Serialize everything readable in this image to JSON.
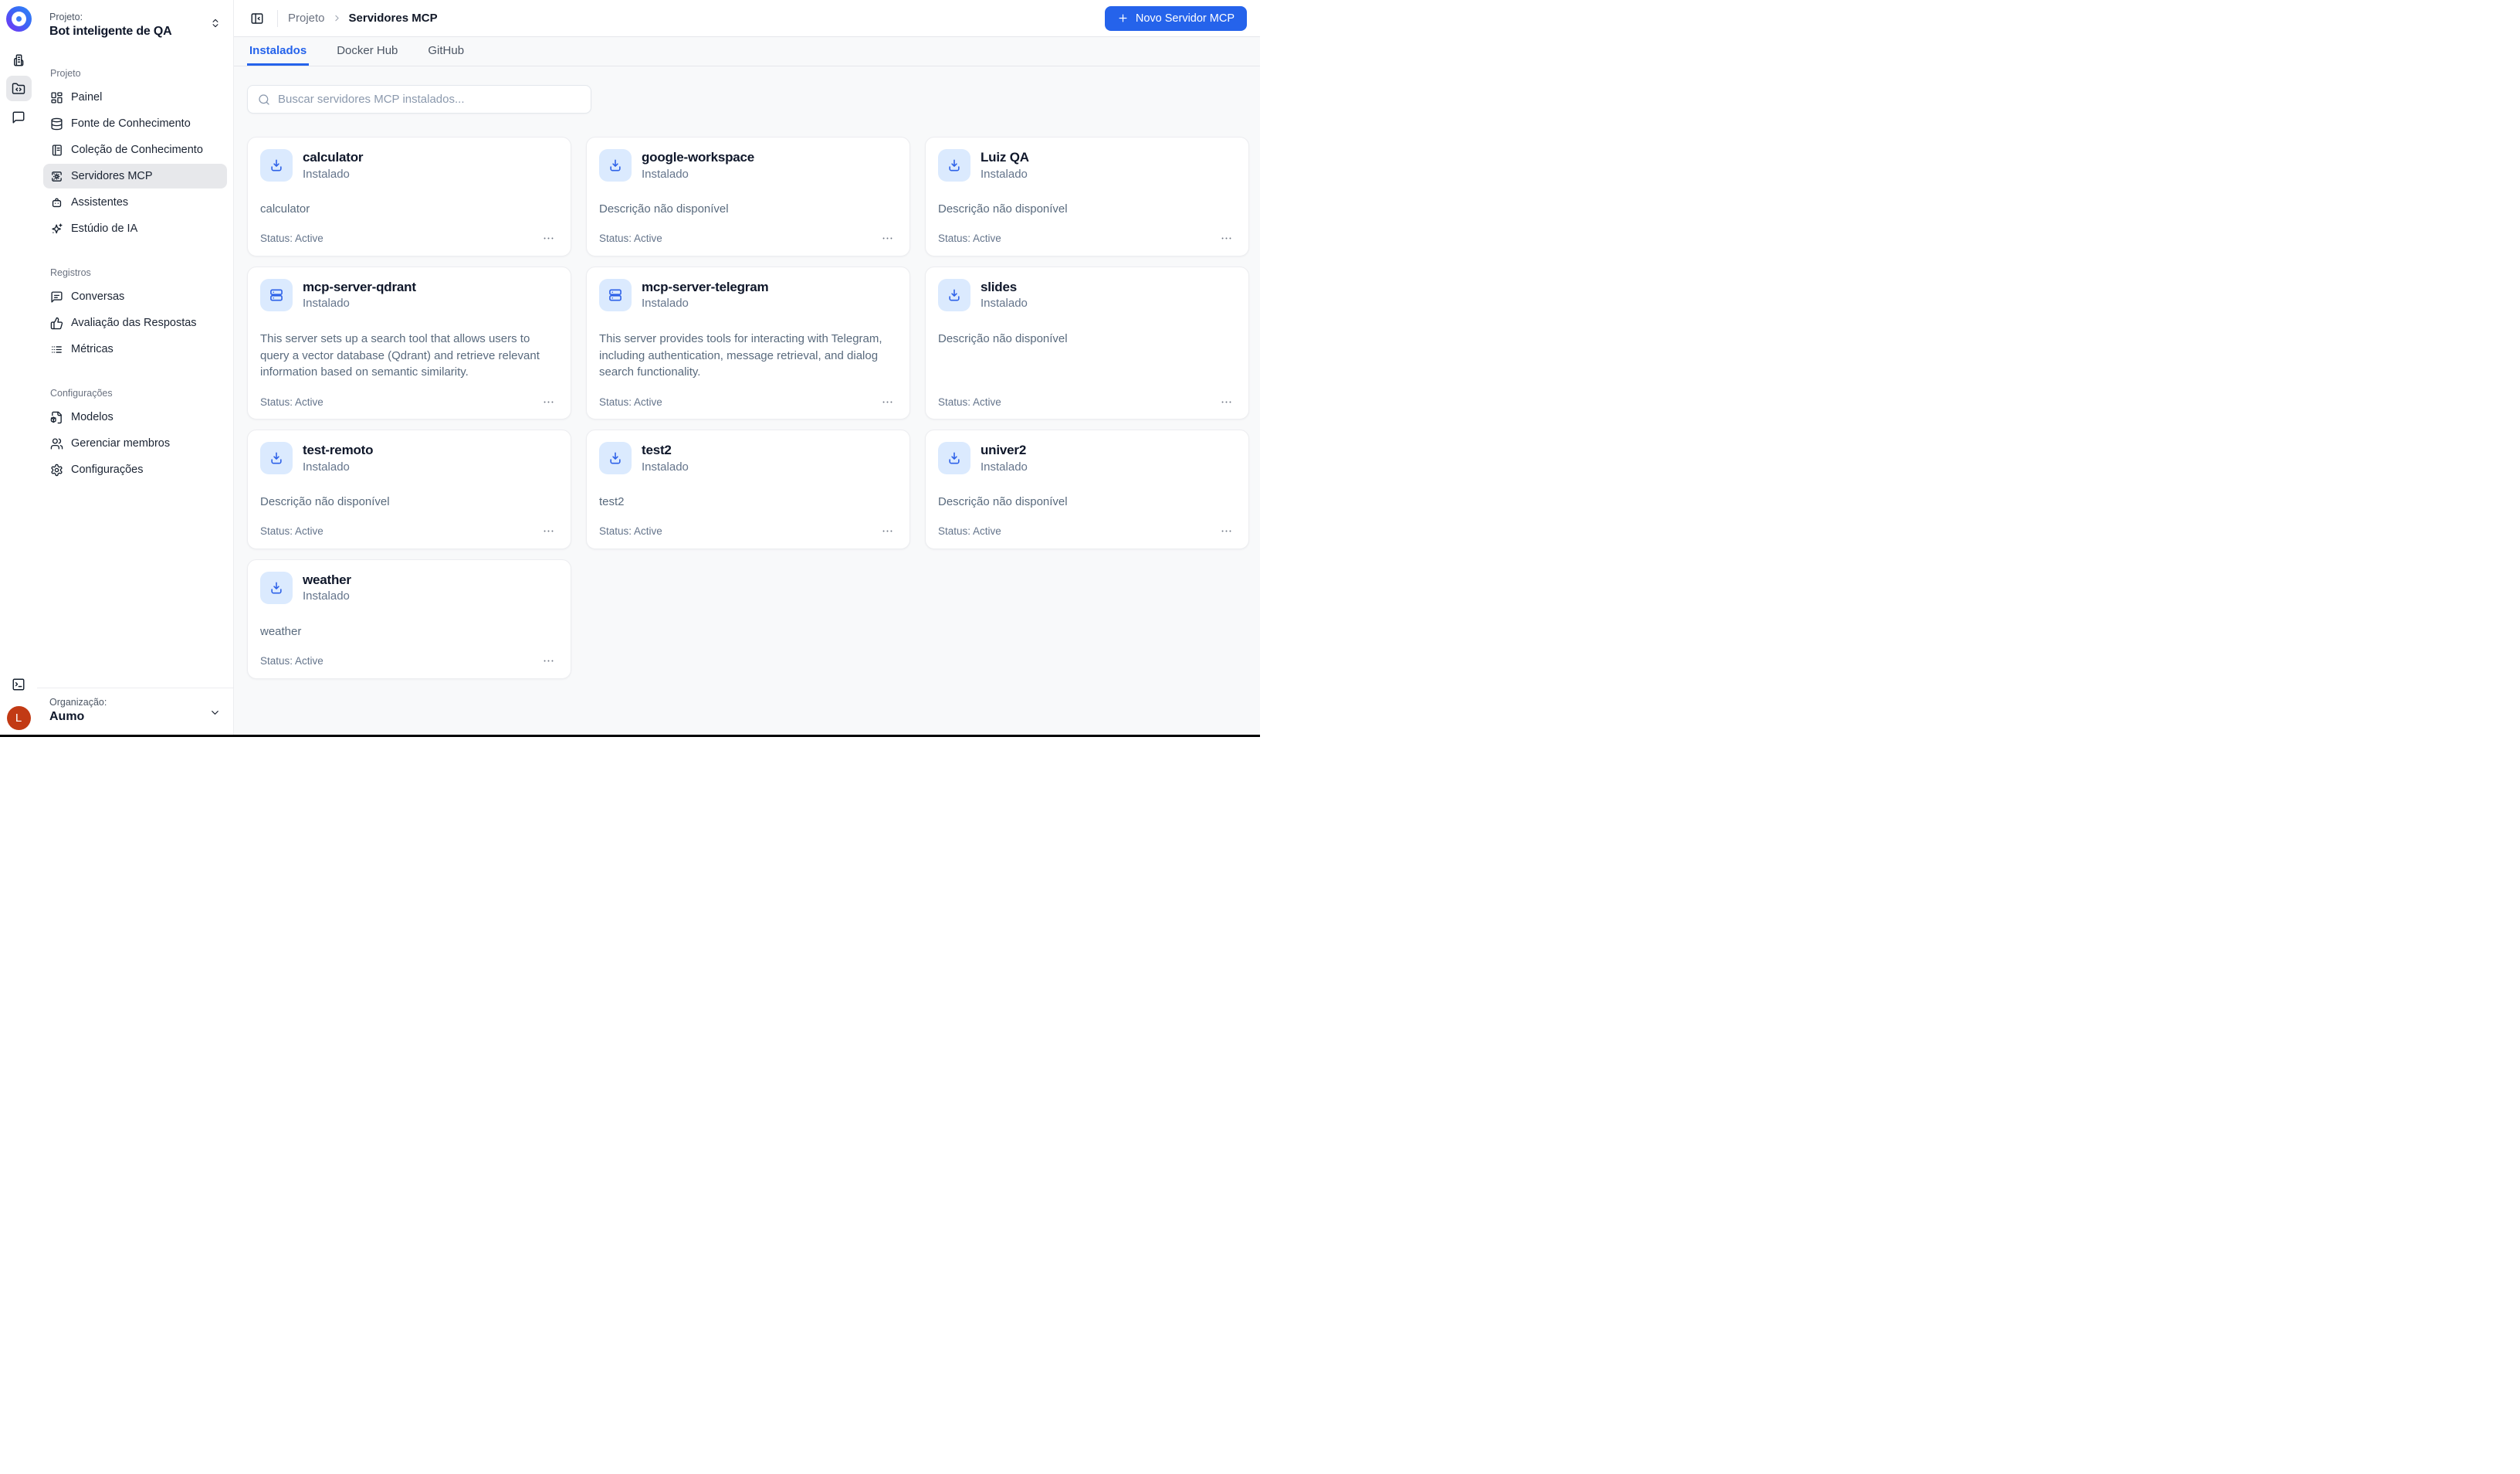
{
  "sidebar": {
    "project_label": "Projeto:",
    "project_name": "Bot inteligente de QA",
    "sections": [
      {
        "label": "Projeto",
        "items": [
          {
            "label": "Painel",
            "icon": "dashboard"
          },
          {
            "label": "Fonte de Conhecimento",
            "icon": "database"
          },
          {
            "label": "Coleção de Conhecimento",
            "icon": "notebook"
          },
          {
            "label": "Servidores MCP",
            "icon": "mcp-server",
            "active": true
          },
          {
            "label": "Assistentes",
            "icon": "bot"
          },
          {
            "label": "Estúdio de IA",
            "icon": "sparkles"
          }
        ]
      },
      {
        "label": "Registros",
        "items": [
          {
            "label": "Conversas",
            "icon": "chat-lines"
          },
          {
            "label": "Avaliação das Respostas",
            "icon": "thumbs-up"
          },
          {
            "label": "Métricas",
            "icon": "list-dots"
          }
        ]
      },
      {
        "label": "Configurações",
        "items": [
          {
            "label": "Modelos",
            "icon": "file-box"
          },
          {
            "label": "Gerenciar membros",
            "icon": "users"
          },
          {
            "label": "Configurações",
            "icon": "gear"
          }
        ]
      }
    ],
    "organization_label": "Organização:",
    "organization_name": "Aumo",
    "avatar_initial": "L",
    "rail_icons": [
      "organization",
      "project-files",
      "chat"
    ],
    "rail_bottom_icon": "terminal"
  },
  "topbar": {
    "breadcrumb_root": "Projeto",
    "breadcrumb_current": "Servidores MCP",
    "new_server_button": "Novo Servidor MCP"
  },
  "tabs": [
    {
      "label": "Instalados",
      "active": true
    },
    {
      "label": "Docker Hub",
      "active": false
    },
    {
      "label": "GitHub",
      "active": false
    }
  ],
  "search": {
    "placeholder": "Buscar servidores MCP instalados..."
  },
  "cards": [
    {
      "name": "calculator",
      "installed": "Instalado",
      "description": "calculator",
      "status": "Status: Active",
      "icon": "download"
    },
    {
      "name": "google-workspace",
      "installed": "Instalado",
      "description": "Descrição não disponível",
      "status": "Status: Active",
      "icon": "download"
    },
    {
      "name": "Luiz QA",
      "installed": "Instalado",
      "description": "Descrição não disponível",
      "status": "Status: Active",
      "icon": "download"
    },
    {
      "name": "mcp-server-qdrant",
      "installed": "Instalado",
      "description": "This server sets up a search tool that allows users to query a vector database (Qdrant) and retrieve relevant information based on semantic similarity.",
      "status": "Status: Active",
      "icon": "server"
    },
    {
      "name": "mcp-server-telegram",
      "installed": "Instalado",
      "description": "This server provides tools for interacting with Telegram, including authentication, message retrieval, and dialog search functionality.",
      "status": "Status: Active",
      "icon": "server"
    },
    {
      "name": "slides",
      "installed": "Instalado",
      "description": "Descrição não disponível",
      "status": "Status: Active",
      "icon": "download"
    },
    {
      "name": "test-remoto",
      "installed": "Instalado",
      "description": "Descrição não disponível",
      "status": "Status: Active",
      "icon": "download"
    },
    {
      "name": "test2",
      "installed": "Instalado",
      "description": "test2",
      "status": "Status: Active",
      "icon": "download"
    },
    {
      "name": "univer2",
      "installed": "Instalado",
      "description": "Descrição não disponível",
      "status": "Status: Active",
      "icon": "download"
    },
    {
      "name": "weather",
      "installed": "Instalado",
      "description": "weather",
      "status": "Status: Active",
      "icon": "download"
    }
  ],
  "colors": {
    "accent": "#2563eb",
    "accent_soft": "#dbeafe",
    "avatar": "#c23a14",
    "content_background": "#f8f9fa",
    "border": "#e5e7eb"
  }
}
